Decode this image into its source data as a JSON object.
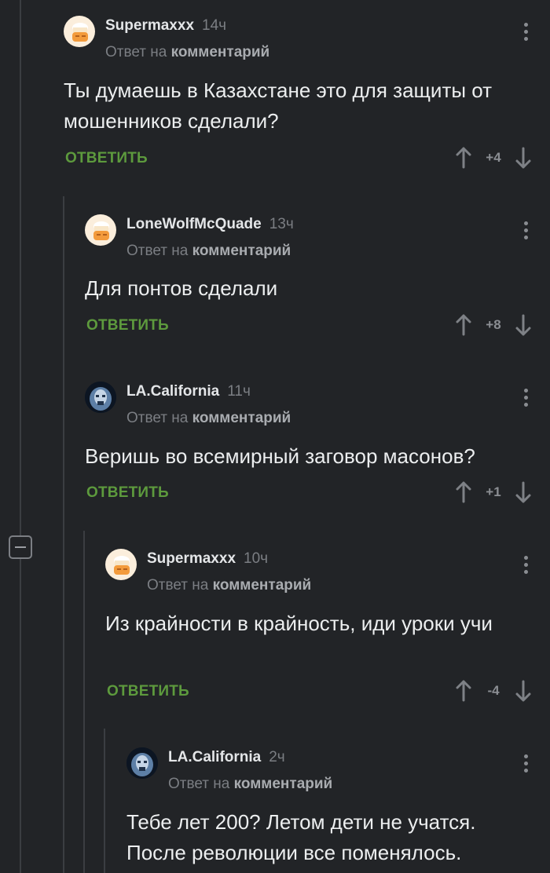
{
  "thread": {
    "collapse_icon": "minus-square-icon",
    "comments": [
      {
        "author": "Supermaxxx",
        "time": "14ч",
        "reply_prefix": "Ответ на",
        "reply_target": "комментарий",
        "text": "Ты думаешь в Казахстане это для защиты от мошенников сделали?",
        "reply_label": "ОТВЕТИТЬ",
        "score": "+4",
        "avatar": "chef-avatar"
      },
      {
        "author": "LoneWolfMcQuade",
        "time": "13ч",
        "reply_prefix": "Ответ на",
        "reply_target": "комментарий",
        "text": "Для понтов сделали",
        "reply_label": "ОТВЕТИТЬ",
        "score": "+8",
        "avatar": "chef-avatar"
      },
      {
        "author": "LA.California",
        "time": "11ч",
        "reply_prefix": "Ответ на",
        "reply_target": "комментарий",
        "text": "Веришь во всемирный заговор масонов?",
        "reply_label": "ОТВЕТИТЬ",
        "score": "+1",
        "avatar": "robot-avatar"
      },
      {
        "author": "Supermaxxx",
        "time": "10ч",
        "reply_prefix": "Ответ на",
        "reply_target": "комментарий",
        "text": "Из крайности в крайность, иди уроки учи",
        "reply_label": "ОТВЕТИТЬ",
        "score": "-4",
        "avatar": "chef-avatar"
      },
      {
        "author": "LA.California",
        "time": "2ч",
        "reply_prefix": "Ответ на",
        "reply_target": "комментарий",
        "text": "Тебе лет 200? Летом дети не учатся. После революции все поменялось.",
        "avatar": "robot-avatar"
      }
    ]
  },
  "colors": {
    "background": "#222427",
    "reply_green": "#5d9a3d",
    "muted_text": "#7b7e83"
  }
}
